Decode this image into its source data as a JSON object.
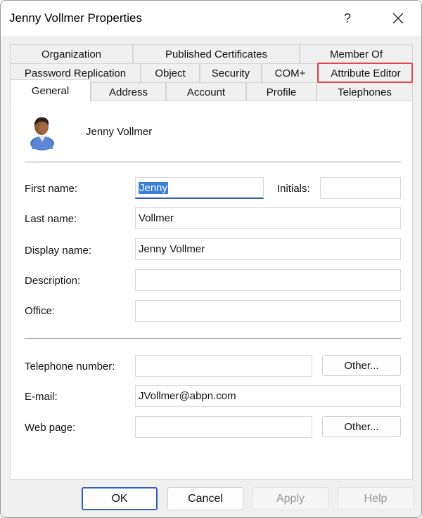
{
  "window": {
    "title": "Jenny Vollmer Properties",
    "help_label": "?",
    "close_icon": "close-icon"
  },
  "tabs": {
    "row1": [
      "Organization",
      "Published Certificates",
      "Member Of"
    ],
    "row2": [
      "Password Replication",
      "Object",
      "Security",
      "COM+",
      "Attribute Editor"
    ],
    "row3": [
      "General",
      "Address",
      "Account",
      "Profile",
      "Telephones"
    ],
    "selected": "General",
    "highlighted": "Attribute Editor",
    "highlight_color": "#e0484f"
  },
  "general": {
    "user_icon": "user-icon",
    "user_name": "Jenny Vollmer",
    "first_name_label": "First name:",
    "first_name_value": "Jenny",
    "initials_label": "Initials:",
    "initials_value": "",
    "last_name_label": "Last name:",
    "last_name_value": "Vollmer",
    "display_name_label": "Display name:",
    "display_name_value": "Jenny Vollmer",
    "description_label": "Description:",
    "description_value": "",
    "office_label": "Office:",
    "office_value": "",
    "telephone_label": "Telephone number:",
    "telephone_value": "",
    "telephone_other_label": "Other...",
    "email_label": "E-mail:",
    "email_value": "JVollmer@abpn.com",
    "webpage_label": "Web page:",
    "webpage_value": "",
    "webpage_other_label": "Other..."
  },
  "footer": {
    "ok_label": "OK",
    "cancel_label": "Cancel",
    "apply_label": "Apply",
    "help_label": "Help"
  }
}
